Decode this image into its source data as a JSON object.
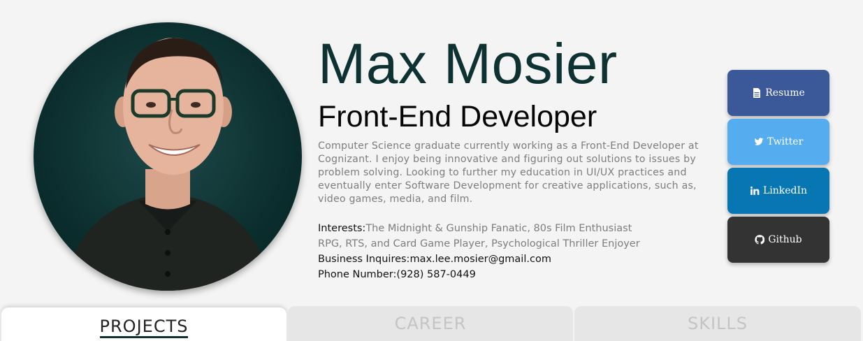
{
  "profile": {
    "name": "Max Mosier",
    "title": "Front-End Developer",
    "bio": "Computer Science graduate currently working as a Front-End Developer at Cognizant. I enjoy being innovative and figuring out solutions to issues by problem solving. Looking to further my education in UI/UX practices and eventually enter Software Development for creative applications, such as, video games, media, and film.",
    "interests_label": "Interests:",
    "interests_line1": "The Midnight & Gunship Fanatic, 80s Film Enthusiast",
    "interests_line2": "RPG, RTS, and Card Game Player, Psychological Thriller Enjoyer",
    "business_label": "Business Inquires:",
    "business_value": "max.lee.mosier@gmail.com",
    "phone_label": "Phone Number:",
    "phone_value": "(928) 587-0449"
  },
  "links": [
    {
      "label": "Resume",
      "icon": "file-icon",
      "color": "#3b5998"
    },
    {
      "label": "Twitter",
      "icon": "twitter-icon",
      "color": "#55acee"
    },
    {
      "label": "LinkedIn",
      "icon": "linkedin-icon",
      "color": "#0976b4"
    },
    {
      "label": "Github",
      "icon": "github-icon",
      "color": "#333333"
    }
  ],
  "tabs": [
    {
      "label": "PROJECTS",
      "active": true
    },
    {
      "label": "CAREER",
      "active": false
    },
    {
      "label": "SKILLS",
      "active": false
    }
  ],
  "colors": {
    "name_color": "#0e3232",
    "page_background": "#f4f4f4",
    "photo_background": "#0d3030"
  }
}
